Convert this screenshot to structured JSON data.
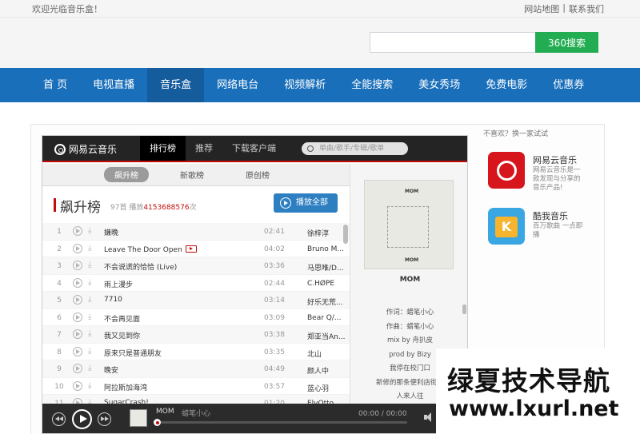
{
  "topbar": {
    "welcome": "欢迎光临音乐盒！",
    "links": [
      "网站地图",
      "|",
      "联系我们"
    ]
  },
  "search": {
    "placeholder": "",
    "button": "360搜索"
  },
  "nav": {
    "items": [
      "首 页",
      "电视直播",
      "音乐盒",
      "网络电台",
      "视频解析",
      "全能搜索",
      "美女秀场",
      "免费电影",
      "优惠券"
    ],
    "active_index": 2
  },
  "player": {
    "logo": "网易云音乐",
    "tabs": [
      "排行榜",
      "推荐",
      "下载客户端"
    ],
    "search_placeholder": "单曲/歌手/专辑/歌单",
    "subtabs": [
      "飙升榜",
      "新歌榜",
      "原创榜"
    ],
    "list_title": "飙升榜",
    "list_meta_prefix": "97首 播放",
    "list_meta_count": "4153688576",
    "list_meta_suffix": "次",
    "play_all": "播放全部",
    "songs": [
      {
        "num": "1",
        "title": "嫌晚",
        "duration": "02:41",
        "artist": "徐梓淳",
        "mv": false
      },
      {
        "num": "2",
        "title": "Leave The Door Open",
        "duration": "04:02",
        "artist": "Bruno M...",
        "mv": true
      },
      {
        "num": "3",
        "title": "不会说谎的恰恰 (Live)",
        "duration": "03:36",
        "artist": "马思唯/D...",
        "mv": false
      },
      {
        "num": "4",
        "title": "雨上漫步",
        "duration": "02:44",
        "artist": "C.HØPE",
        "mv": false
      },
      {
        "num": "5",
        "title": "7710",
        "duration": "03:14",
        "artist": "好乐无荒...",
        "mv": false
      },
      {
        "num": "6",
        "title": "不会再见面",
        "duration": "03:09",
        "artist": "Bear Q/...",
        "mv": false
      },
      {
        "num": "7",
        "title": "我又见到你",
        "duration": "03:38",
        "artist": "郑亚当An...",
        "mv": false
      },
      {
        "num": "8",
        "title": "原来只是普通朋友",
        "duration": "03:35",
        "artist": "北山",
        "mv": false
      },
      {
        "num": "9",
        "title": "晚安",
        "duration": "04:49",
        "artist": "颜人中",
        "mv": false
      },
      {
        "num": "10",
        "title": "阿拉斯加海湾",
        "duration": "03:57",
        "artist": "蓝心羽",
        "mv": false
      },
      {
        "num": "11",
        "title": "SugarCrash!",
        "duration": "01:20",
        "artist": "ElyOtto",
        "mv": false
      }
    ],
    "album": {
      "cover_label_top": "MOM",
      "cover_label_bottom": "MOM",
      "name": "MOM"
    },
    "lyrics": [
      "作词：蜡笔小心",
      "作曲：蜡笔小心",
      "mix by 舟扒皮",
      "prod by Bizy",
      "我停在校门口",
      "新修的那条便利店街道",
      "人来人往"
    ],
    "now_playing": {
      "title": "MOM",
      "artist": "蜡笔小心",
      "time": "00:00 / 00:00",
      "progress": 0
    }
  },
  "recommend": {
    "heading": "不喜欢？换一家试试",
    "apps": [
      {
        "name": "网易云音乐",
        "desc": "网易云音乐是一款发现与分享的音乐产品!",
        "icon": "netease-music-icon"
      },
      {
        "name": "酷我音乐",
        "desc": "百万歌曲 一点即播",
        "icon": "kuwo-music-icon"
      }
    ]
  },
  "watermark": {
    "line1": "绿夏技术导航",
    "line2": "www.lxurl.net"
  },
  "colors": {
    "nav_bg": "#1a6fbb",
    "accent_red": "#c20c0c",
    "search_btn": "#23ad52",
    "play_all": "#2d7fc1"
  }
}
